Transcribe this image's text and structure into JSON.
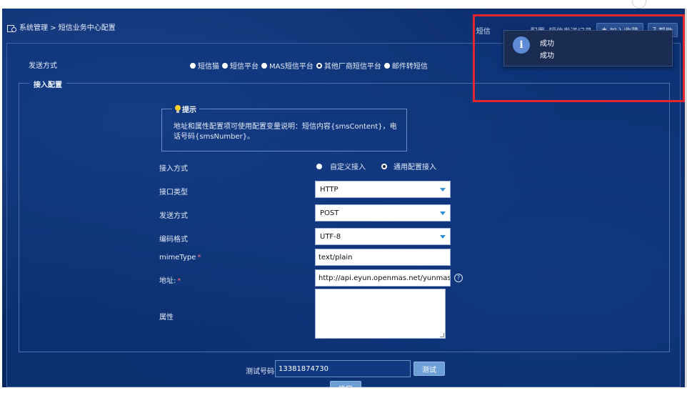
{
  "breadcrumb": {
    "root": "系统管理",
    "separator": ">",
    "current": "短信业务中心配置"
  },
  "header_tabs": {
    "tab1": "短信",
    "tab2": "配置",
    "tab3": "短信发送记录",
    "favorite_button": "加入收藏",
    "help_button": "帮助"
  },
  "send_method": {
    "label": "发送方式",
    "options": [
      "短信猫",
      "短信平台",
      "MAS短信平台",
      "其他厂商短信平台",
      "邮件转短信"
    ],
    "selected": "其他厂商短信平台"
  },
  "access_config": {
    "legend": "接入配置",
    "tip_title": "提示",
    "tip_text": "地址和属性配置项可使用配置变量说明：短信内容{smsContent}，电话号码{smsNumber}。",
    "access_mode_label": "接入方式",
    "access_mode_options": [
      "自定义接入",
      "通用配置接入"
    ],
    "access_mode_selected": "通用配置接入",
    "interface_type_label": "接口类型",
    "interface_type_value": "HTTP",
    "http_method_label": "发送方式",
    "http_method_value": "POST",
    "encoding_label": "编码格式",
    "encoding_value": "UTF-8",
    "mime_label": "mimeType",
    "mime_value": "text/plain",
    "address_label": "地址:",
    "address_value": "http://api.eyun.openmas.net/yunmas_api/S",
    "property_label": "属性",
    "required_mark": "*",
    "help_symbol": "?"
  },
  "test": {
    "label": "测试号码",
    "value": "13381874730",
    "button": "测试"
  },
  "confirm_button": "确定",
  "toast": {
    "title": "成功",
    "message": "成功",
    "icon": "i"
  },
  "colors": {
    "highlight_box": "#e5272d",
    "background": "#0b2a66",
    "button": "#6e9ed6"
  }
}
